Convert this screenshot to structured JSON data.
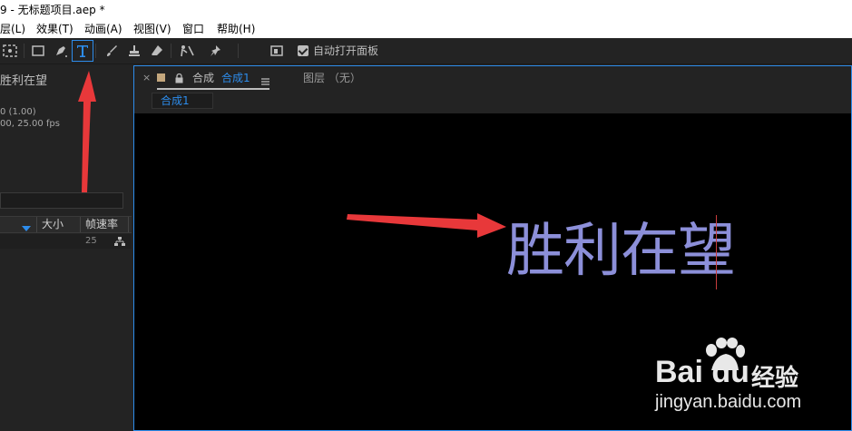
{
  "window": {
    "title": "9 - 无标题项目.aep *"
  },
  "menu": [
    {
      "label": "层(L)"
    },
    {
      "label": "效果(T)"
    },
    {
      "label": "动画(A)"
    },
    {
      "label": "视图(V)"
    },
    {
      "label": "窗口"
    },
    {
      "label": "帮助(H)"
    }
  ],
  "toolbar": {
    "auto_open_label": "自动打开面板",
    "auto_open_checked": true,
    "tools": [
      "selection-marquee-icon",
      "rectangle-icon",
      "pen-icon",
      "type-icon",
      "brush-icon",
      "clone-stamp-icon",
      "eraser-icon",
      "roto-brush-icon",
      "puppet-pin-icon"
    ],
    "active_tool": "type-icon",
    "accent_color": "#2d8ceb"
  },
  "project": {
    "item_name": "胜利在望",
    "info_line1": "0 (1.00)",
    "info_line2": "00, 25.00 fps",
    "columns": [
      "大小",
      "帧速率"
    ],
    "row": {
      "frame_rate": "25"
    }
  },
  "comp_panel": {
    "tab_prefix": "合成",
    "tab_name": "合成1",
    "layer_tab": "图层 （无）",
    "subtab": "合成1"
  },
  "viewer": {
    "text": "胜利在望",
    "text_color": "#8c8fd9",
    "background": "#000000"
  },
  "watermark": {
    "brand": "Bai du",
    "jingyan": "经验",
    "url": "jingyan.baidu.com"
  },
  "annotations": {
    "arrow_color": "#e8383a"
  }
}
